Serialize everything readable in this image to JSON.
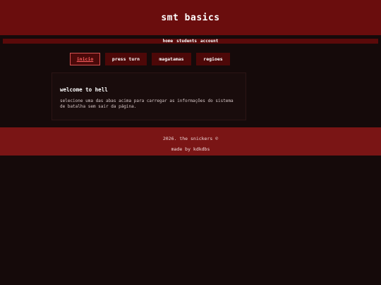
{
  "header": {
    "title": "smt basics"
  },
  "nav": {
    "items": [
      "home",
      "students",
      "account"
    ]
  },
  "tabs": [
    "inicio",
    "press turn",
    "magatamas",
    "regioes"
  ],
  "panel": {
    "heading": "welcome to hell",
    "text": "selecione uma das abas acima para carregar as informações do sistema de batalha sem sair da página."
  },
  "footer": {
    "copyright": "2026. the snickers ©",
    "credit": "made by kdkdbs"
  },
  "colors": {
    "header_bg": "#6a0d0d",
    "page_bg": "#150a0a",
    "tab_bg": "#4d0808",
    "tab_active": "#ff6060",
    "footer_bg": "#7a1515"
  }
}
